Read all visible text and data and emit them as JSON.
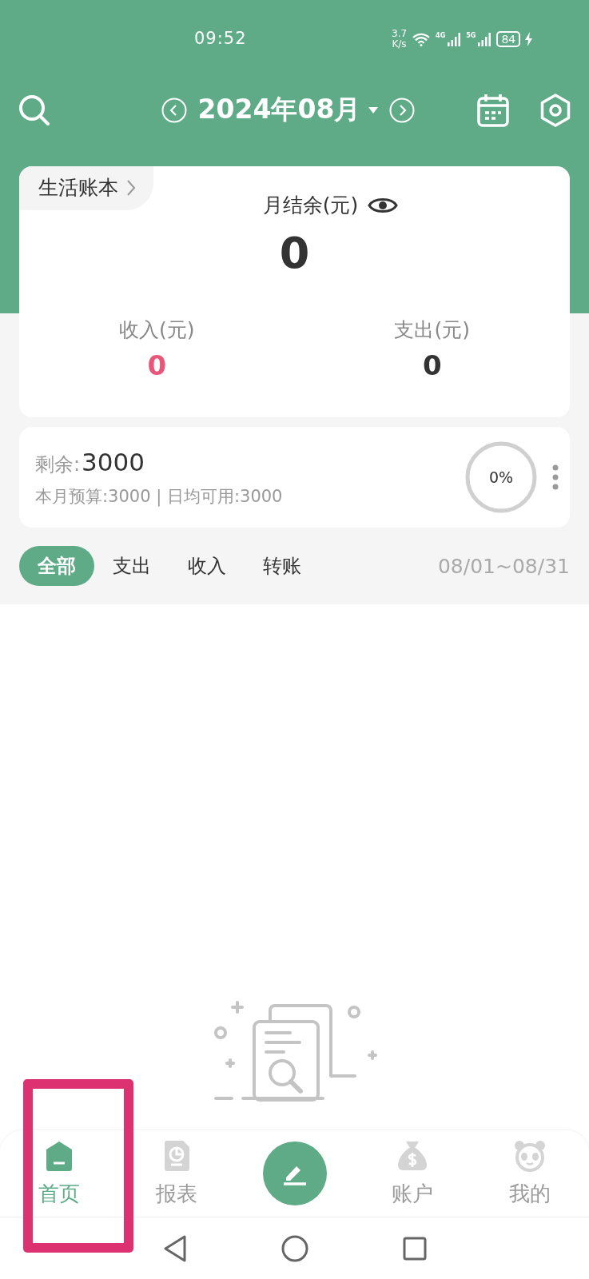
{
  "status_bar": {
    "time": "09:52",
    "net_speed": "3.7",
    "net_unit": "K/s",
    "networks": [
      "4G",
      "5G"
    ],
    "battery": "84",
    "charging": true
  },
  "header": {
    "month": "2024年08月"
  },
  "summary": {
    "book": "生活账本",
    "balance_label": "月结余(元)",
    "balance": "0",
    "income_label": "收入(元)",
    "income": "0",
    "expense_label": "支出(元)",
    "expense": "0"
  },
  "budget": {
    "remaining_label": "剩余:",
    "remaining": "3000",
    "detail": "本月预算:3000 | 日均可用:3000",
    "used": "0%"
  },
  "filter_tabs": [
    {
      "label": "全部",
      "selected": true
    },
    {
      "label": "支出",
      "selected": false
    },
    {
      "label": "收入",
      "selected": false
    },
    {
      "label": "转账",
      "selected": false
    }
  ],
  "date_range": "08/01~08/31",
  "nav": [
    {
      "kind": "home",
      "label": "首页",
      "selected": true,
      "highlighted": true
    },
    {
      "kind": "report",
      "label": "报表",
      "selected": false,
      "highlighted": false
    },
    {
      "kind": "add",
      "highlighted": false
    },
    {
      "kind": "account",
      "label": "账户",
      "selected": false,
      "highlighted": false
    },
    {
      "kind": "me",
      "label": "我的",
      "selected": false,
      "highlighted": false
    }
  ]
}
